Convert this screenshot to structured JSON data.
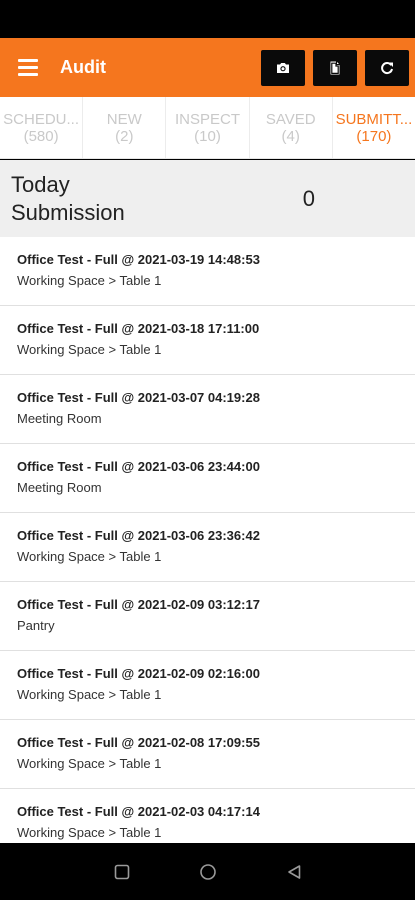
{
  "header": {
    "title": "Audit",
    "actions": [
      {
        "icon": "camera-icon"
      },
      {
        "icon": "document-icon"
      },
      {
        "icon": "refresh-icon"
      }
    ]
  },
  "tabs": [
    {
      "label": "SCHEDU...",
      "count": "(580)",
      "active": false
    },
    {
      "label": "NEW",
      "count": "(2)",
      "active": false
    },
    {
      "label": "INSPECT",
      "count": "(10)",
      "active": false
    },
    {
      "label": "SAVED",
      "count": "(4)",
      "active": false
    },
    {
      "label": "SUBMITT...",
      "count": "(170)",
      "active": true
    }
  ],
  "summary": {
    "label": "Today Submission",
    "count": "0"
  },
  "submissions": [
    {
      "title": "Office Test - Full @ 2021-03-19 14:48:53",
      "location": "Working Space > Table 1"
    },
    {
      "title": "Office Test - Full @ 2021-03-18 17:11:00",
      "location": "Working Space > Table 1"
    },
    {
      "title": "Office Test - Full @ 2021-03-07 04:19:28",
      "location": "Meeting Room"
    },
    {
      "title": "Office Test - Full @ 2021-03-06 23:44:00",
      "location": "Meeting Room"
    },
    {
      "title": "Office Test - Full @ 2021-03-06 23:36:42",
      "location": "Working Space > Table 1"
    },
    {
      "title": "Office Test - Full @ 2021-02-09 03:12:17",
      "location": "Pantry"
    },
    {
      "title": "Office Test - Full @ 2021-02-09 02:16:00",
      "location": "Working Space > Table 1"
    },
    {
      "title": "Office Test - Full @ 2021-02-08 17:09:55",
      "location": "Working Space > Table 1"
    },
    {
      "title": "Office Test - Full @ 2021-02-03 04:17:14",
      "location": "Working Space > Table 1"
    }
  ],
  "colors": {
    "accent": "#f5761e",
    "tab_inactive": "#c9c9c9",
    "summary_bg": "#efefef"
  },
  "nav": [
    {
      "icon": "recents-icon"
    },
    {
      "icon": "home-icon"
    },
    {
      "icon": "back-icon"
    }
  ]
}
